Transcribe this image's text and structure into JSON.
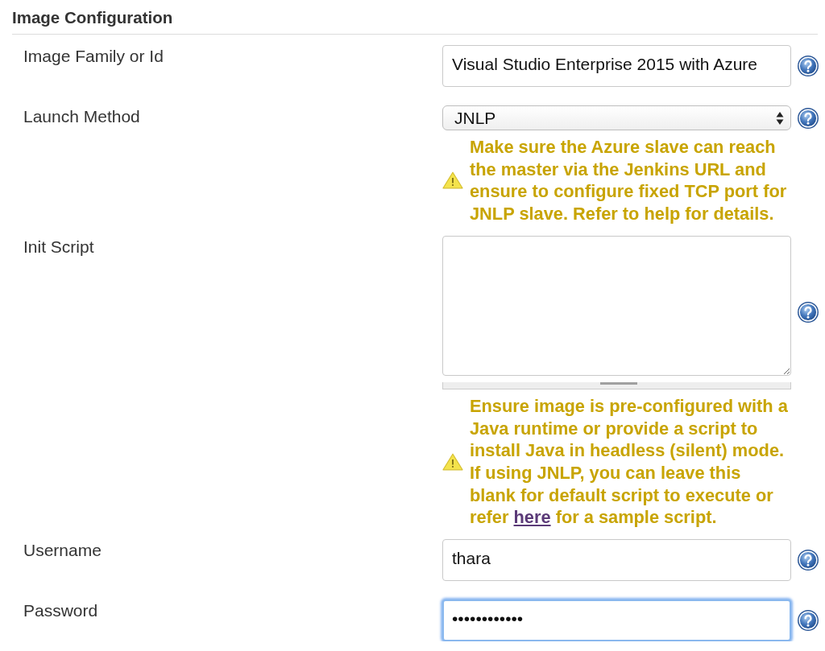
{
  "section": {
    "title": "Image Configuration"
  },
  "fields": [
    {
      "kind": "text",
      "label": "Image Family or Id",
      "value": "Visual Studio Enterprise 2015 with Azure",
      "focused": false
    },
    {
      "kind": "select",
      "label": "Launch Method",
      "value": "JNLP",
      "warning": {
        "text": "Make sure the Azure slave can reach the master via the Jenkins URL and ensure to configure fixed TCP port for JNLP slave. Refer to help for details."
      }
    },
    {
      "kind": "textarea",
      "label": "Init Script",
      "warning": {
        "text": "Ensure image is pre-configured with a Java runtime or provide a script to install Java in headless (silent) mode. If using JNLP, you can leave this blank for default script to execute or refer",
        "link": "here",
        "text_after": "for a sample script."
      }
    },
    {
      "kind": "text",
      "label": "Username",
      "value": "thara",
      "focused": false
    },
    {
      "kind": "password",
      "label": "Password",
      "value": "••••••••••••",
      "focused": true
    }
  ]
}
